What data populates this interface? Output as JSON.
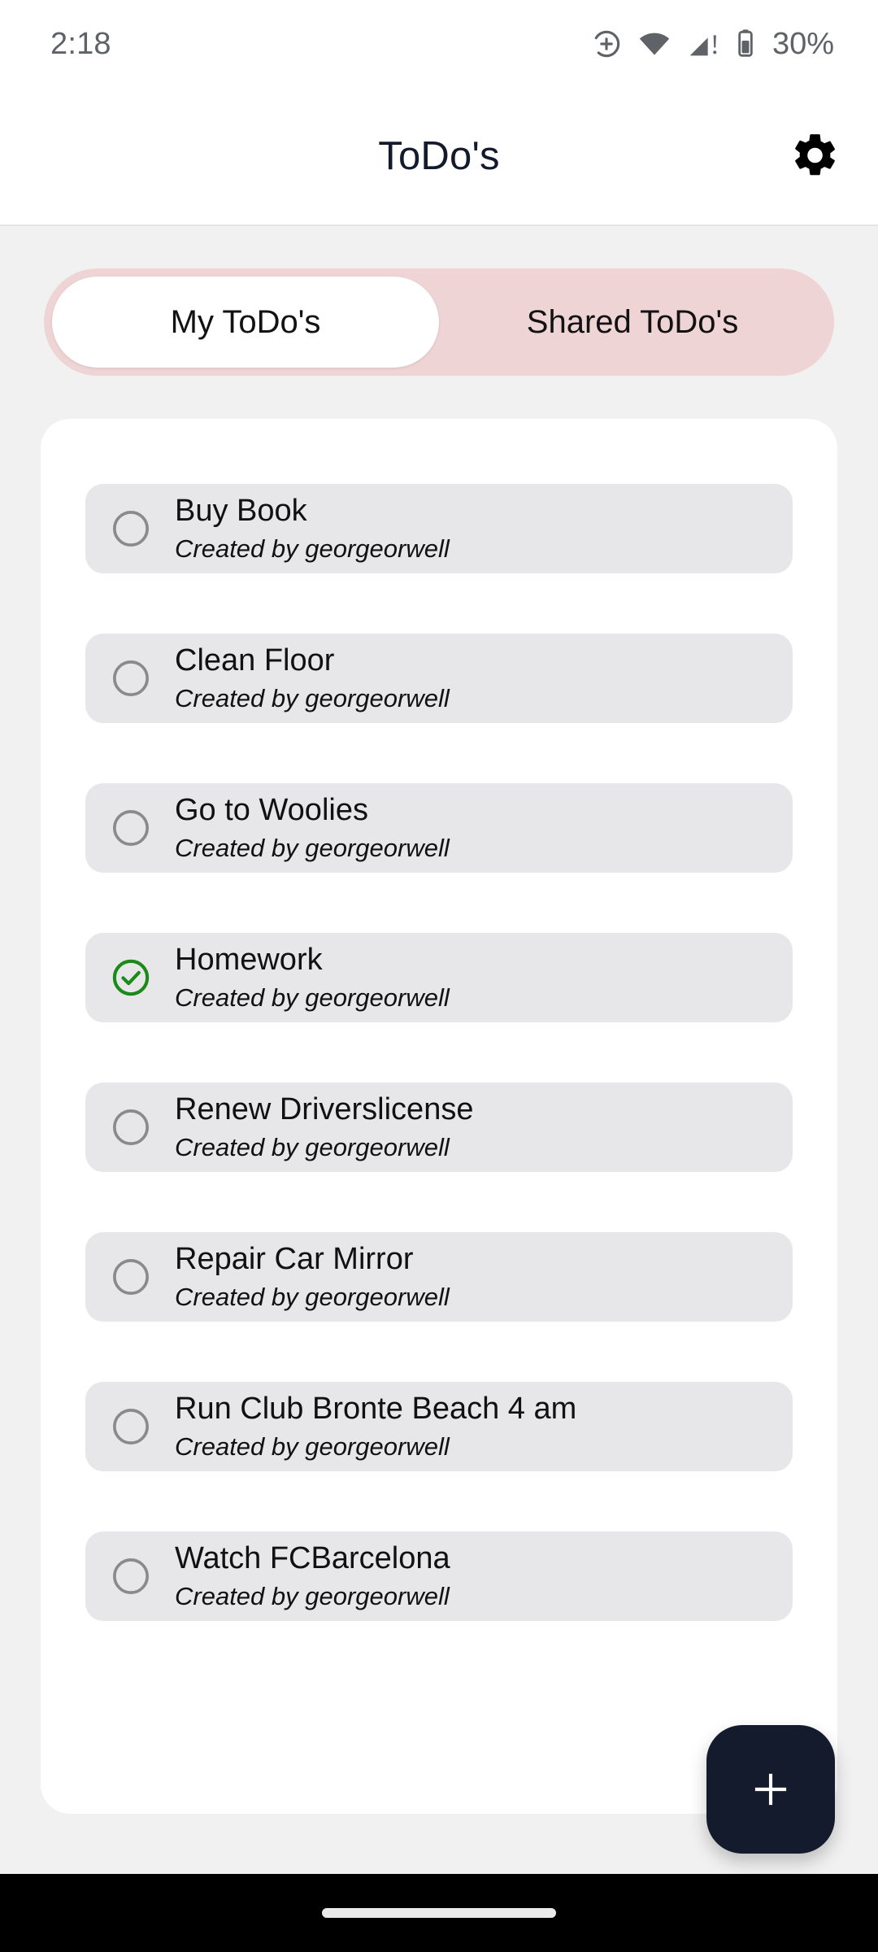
{
  "status_bar": {
    "clock": "2:18",
    "battery_percent": "30%",
    "icons": [
      "data-saver-icon",
      "wifi-icon",
      "cellular-signal-alert-icon",
      "battery-icon"
    ]
  },
  "app_bar": {
    "title": "ToDo's",
    "settings_icon": "gear-icon"
  },
  "tabs": {
    "items": [
      {
        "label": "My ToDo's",
        "active": true
      },
      {
        "label": "Shared ToDo's",
        "active": false
      }
    ]
  },
  "todos": [
    {
      "title": "Buy Book",
      "subtitle": "Created by georgeorwell",
      "done": false
    },
    {
      "title": "Clean Floor",
      "subtitle": "Created by georgeorwell",
      "done": false
    },
    {
      "title": "Go to Woolies",
      "subtitle": "Created by georgeorwell",
      "done": false
    },
    {
      "title": "Homework",
      "subtitle": "Created by georgeorwell",
      "done": true
    },
    {
      "title": "Renew Driverslicense",
      "subtitle": "Created by georgeorwell",
      "done": false
    },
    {
      "title": "Repair Car Mirror",
      "subtitle": "Created by georgeorwell",
      "done": false
    },
    {
      "title": "Run Club Bronte Beach 4 am",
      "subtitle": "Created by georgeorwell",
      "done": false
    },
    {
      "title": "Watch FCBarcelona",
      "subtitle": "Created by georgeorwell",
      "done": false
    }
  ],
  "fab": {
    "icon": "plus-icon",
    "label": "+"
  },
  "nav_bar": {
    "handle": "gesture-handle"
  },
  "colors": {
    "tab_track": "#efd4d6",
    "tab_active": "#ffffff",
    "card": "#ffffff",
    "item": "#e7e7e9",
    "page_background": "#f1f1f1",
    "title": "#131a2b",
    "fab": "#141b2d",
    "check_done": "#1a8a18",
    "check_pending": "#8a8a8a"
  }
}
